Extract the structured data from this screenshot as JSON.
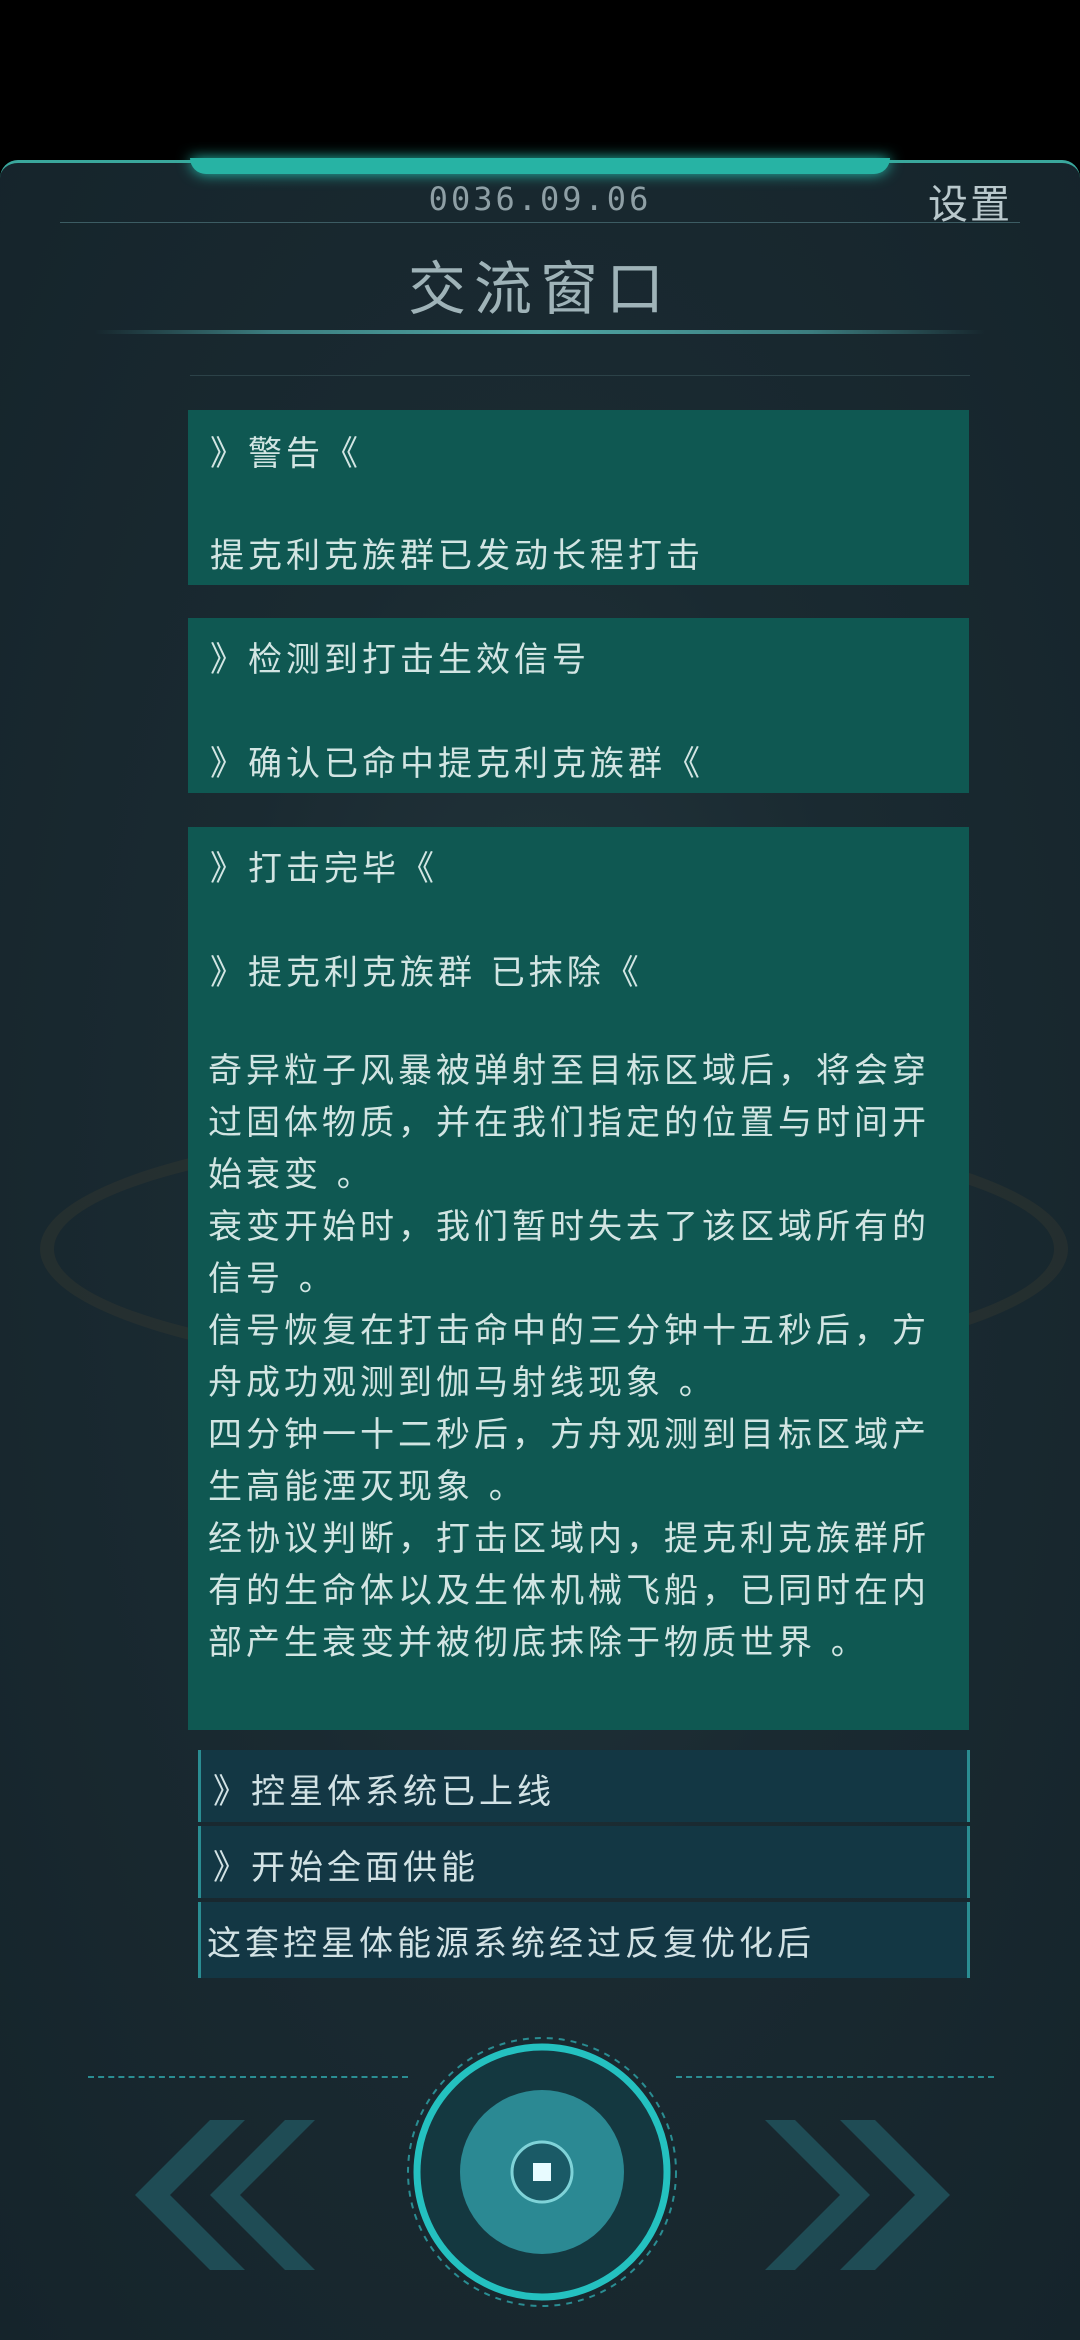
{
  "header": {
    "date": "0036.09.06",
    "settings_label": "设置",
    "title": "交流窗口"
  },
  "cards": [
    {
      "lines": [
        "》警告《",
        "提克利克族群已发动长程打击"
      ]
    },
    {
      "lines": [
        "》检测到打击生效信号",
        "》确认已命中提克利克族群《"
      ]
    },
    {
      "lines": [
        "》打击完毕《",
        "》提克利克族群 已抹除《"
      ],
      "paragraphs": [
        "奇异粒子风暴被弹射至目标区域后，将会穿过固体物质，并在我们指定的位置与时间开始衰变 。",
        "衰变开始时，我们暂时失去了该区域所有的信号 。",
        "信号恢复在打击命中的三分钟十五秒后，方舟成功观测到伽马射线现象 。",
        "四分钟一十二秒后，方舟观测到目标区域产生高能湮灭现象 。",
        "经协议判断，打击区域内，提克利克族群所有的生命体以及生体机械飞船，已同时在内部产生衰变并被彻底抹除于物质世界 。"
      ]
    }
  ],
  "options": [
    "》控星体系统已上线",
    "》开始全面供能",
    "这套控星体能源系统经过反复优化后"
  ],
  "controls": {
    "prev_icon": "double-chevron-left-icon",
    "next_icon": "double-chevron-right-icon",
    "center_icon": "ring-button-icon"
  },
  "colors": {
    "card_bg": "#0f5852",
    "option_bg": "#133744",
    "accent": "#27b3a4"
  }
}
